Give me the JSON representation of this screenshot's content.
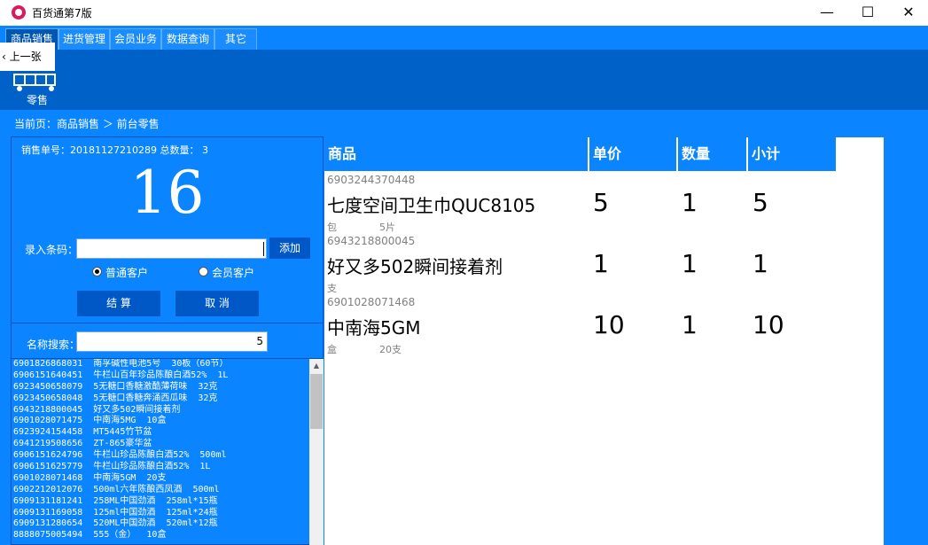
{
  "window": {
    "title": "百货通第7版",
    "minimize": "—",
    "maximize": "☐",
    "close": "✕"
  },
  "menu": {
    "tabs": [
      "商品销售",
      "进货管理",
      "会员业务",
      "数据查询",
      "其它"
    ]
  },
  "ribbon": {
    "prev_label": "上一张",
    "retail_label": "零售"
  },
  "breadcrumb": "当前页：商品销售 ＞ 前台零售",
  "order": {
    "info": "销售单号：20181127210289 总数量： 3",
    "total": "16"
  },
  "barcode_entry": {
    "label": "录入条码：",
    "value": "",
    "add_label": "添加"
  },
  "customer_type": {
    "regular": "普通客户",
    "member": "会员客户",
    "selected": "regular"
  },
  "actions": {
    "checkout": "结  算",
    "cancel": "取  消"
  },
  "name_search": {
    "label": "名称搜索：",
    "value": "5"
  },
  "search_results": [
    "6901826868031  南孚碱性电池5号  30板（60节）",
    "6906151640451  牛栏山百年珍品陈酿白酒52%  1L",
    "6923450658079  5无糖口香糖激酷薄荷味  32克",
    "6923450658048  5无糖口香糖奔涌西瓜味  32克",
    "6943218800045  好又多502瞬间接着剂",
    "6901028071475  中南海5MG  10盒",
    "6923924154458  MT5445竹节盆",
    "6941219508656  ZT-865豪华盆",
    "6906151624796  牛栏山珍品陈酿白酒52%  500ml",
    "6906151625779  牛栏山珍品陈酿白酒52%  1L",
    "6901028071468  中南海5GM  20支",
    "6902212012076  500ml六年陈酿西凤酒  500ml",
    "6909131181241  258ML中国劲酒  258ml*15瓶",
    "6909131169058  125ml中国劲酒  125ml*24瓶",
    "6909131280654  520ML中国劲酒  520ml*12瓶",
    "8888075005494  555（金）  10盒"
  ],
  "cart": {
    "headers": {
      "product": "商品",
      "price": "单价",
      "qty": "数量",
      "subtotal": "小计"
    },
    "items": [
      {
        "barcode": "6903244370448",
        "name": "七度空间卫生巾QUC8105",
        "unit": "包",
        "spec": "5片",
        "price": "5",
        "qty": "1",
        "subtotal": "5"
      },
      {
        "barcode": "6943218800045",
        "name": "好又多502瞬间接着剂",
        "unit": "支",
        "spec": "",
        "price": "1",
        "qty": "1",
        "subtotal": "1"
      },
      {
        "barcode": "6901028071468",
        "name": "中南海5GM",
        "unit": "盒",
        "spec": "20支",
        "price": "10",
        "qty": "1",
        "subtotal": "10"
      }
    ]
  }
}
